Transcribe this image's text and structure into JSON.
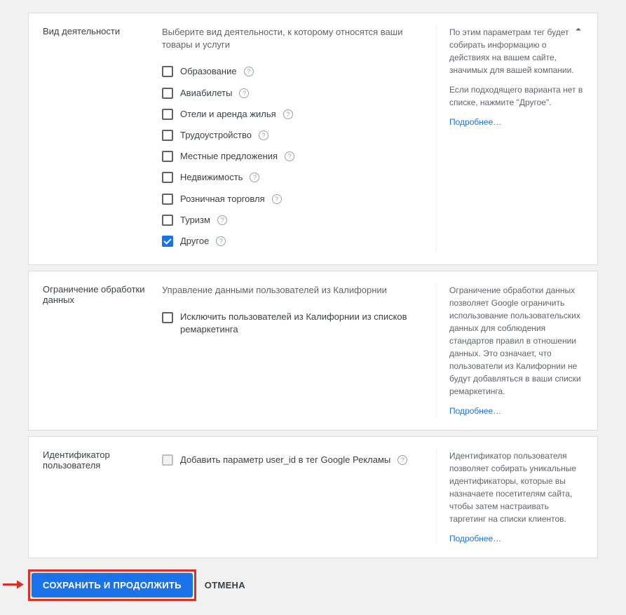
{
  "section1": {
    "label": "Вид деятельности",
    "instruction": "Выберите вид деятельности, к которому относятся ваши товары и услуги",
    "options": [
      {
        "label": "Образование",
        "checked": false
      },
      {
        "label": "Авиабилеты",
        "checked": false
      },
      {
        "label": "Отели и аренда жилья",
        "checked": false
      },
      {
        "label": "Трудоустройство",
        "checked": false
      },
      {
        "label": "Местные предложения",
        "checked": false
      },
      {
        "label": "Недвижимость",
        "checked": false
      },
      {
        "label": "Розничная торговля",
        "checked": false
      },
      {
        "label": "Туризм",
        "checked": false
      },
      {
        "label": "Другое",
        "checked": true
      }
    ],
    "side": {
      "p1": "По этим параметрам тег будет собирать информацию о действиях на вашем сайте, значимых для вашей компании.",
      "p2": "Если подходящего варианта нет в списке, нажмите \"Другое\".",
      "link": "Подробнее…"
    }
  },
  "section2": {
    "label": "Ограничение обработки данных",
    "instruction": "Управление данными пользователей из Калифорнии",
    "checkbox_label": "Исключить пользователей из Калифорнии из списков ремаркетинга",
    "side": {
      "p1": "Ограничение обработки данных позволяет Google ограничить использование пользовательских данных для соблюдения стандартов правил в отношении данных. Это означает, что пользователи из Калифорнии не будут добавляться в ваши списки ремаркетинга.",
      "link": "Подробнее…"
    }
  },
  "section3": {
    "label": "Идентификатор пользователя",
    "checkbox_label": "Добавить параметр user_id в тег Google Рекламы",
    "side": {
      "p1": "Идентификатор пользователя позволяет собирать уникальные идентификаторы, которые вы назначаете посетителям сайта, чтобы затем настраивать таргетинг на списки клиентов.",
      "link": "Подробнее…"
    }
  },
  "buttons": {
    "save": "СОХРАНИТЬ И ПРОДОЛЖИТЬ",
    "cancel": "ОТМЕНА"
  }
}
